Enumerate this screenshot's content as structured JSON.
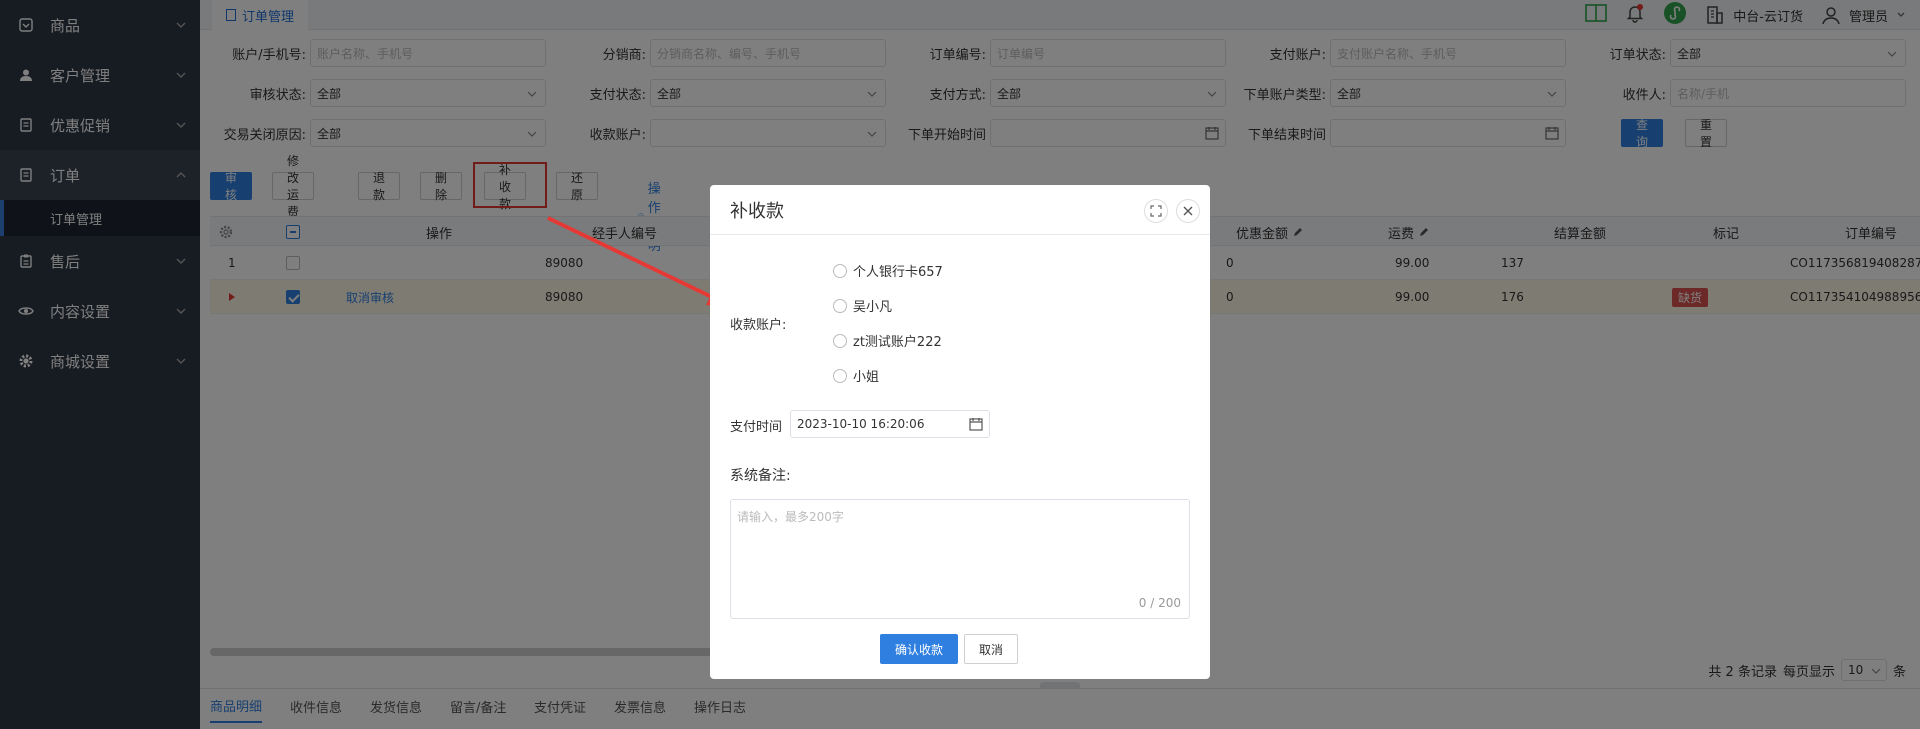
{
  "sidebar": {
    "items": [
      {
        "label": "商品",
        "icon": "box-icon"
      },
      {
        "label": "客户管理",
        "icon": "user-icon"
      },
      {
        "label": "优惠促销",
        "icon": "coupon-icon"
      },
      {
        "label": "订单",
        "icon": "order-icon"
      },
      {
        "label": "售后",
        "icon": "aftersale-icon"
      },
      {
        "label": "内容设置",
        "icon": "eye-icon"
      },
      {
        "label": "商城设置",
        "icon": "gear-icon"
      }
    ],
    "sub_active": "订单管理"
  },
  "tabs": {
    "active": "订单管理"
  },
  "header": {
    "org": "中台-云订货",
    "user": "管理员"
  },
  "filters": {
    "account_label": "账户/手机号:",
    "account_ph": "账户名称、手机号",
    "distributor_label": "分销商:",
    "distributor_ph": "分销商名称、编号、手机号",
    "order_no_label": "订单编号:",
    "order_no_ph": "订单编号",
    "pay_account_label": "支付账户:",
    "pay_account_ph": "支付账户名称、手机号",
    "order_status_label": "订单状态:",
    "order_status_val": "全部",
    "audit_label": "审核状态:",
    "audit_val": "全部",
    "pay_status_label": "支付状态:",
    "pay_status_val": "全部",
    "pay_method_label": "支付方式:",
    "pay_method_val": "全部",
    "acct_type_label": "下单账户类型:",
    "acct_type_val": "全部",
    "receiver_label": "收件人:",
    "receiver_ph": "名称/手机",
    "close_reason_label": "交易关闭原因:",
    "close_reason_val": "全部",
    "collect_acct_label": "收款账户:",
    "collect_acct_val": "",
    "start_label": "下单开始时间",
    "end_label": "下单结束时间",
    "query": "查询",
    "reset": "重置"
  },
  "toolbar": {
    "audit": "审核",
    "modify_freight": "修改运费",
    "refund": "退款",
    "delete": "删除",
    "supplement": "补收款",
    "restore": "还原",
    "help": "操作说明"
  },
  "table": {
    "headers": {
      "op": "操作",
      "agent": "经手人编号",
      "discount": "优惠金额",
      "freight": "运费",
      "settle": "结算金额",
      "mark": "标记",
      "order_no": "订单编号"
    },
    "rows": [
      {
        "idx": "1",
        "op": "",
        "agent": "89080",
        "discount": "0",
        "freight": "99.00",
        "settle": "137",
        "mark": "",
        "order_no": "CO117356819408287"
      },
      {
        "idx": "",
        "op": "取消审核",
        "agent": "89080",
        "discount": "0",
        "freight": "99.00",
        "settle": "176",
        "mark": "缺货",
        "order_no": "CO117354104988956"
      }
    ]
  },
  "pager": {
    "total": "共 2 条记录",
    "per_page_label": "每页显示",
    "per_page": "10",
    "unit": "条"
  },
  "bottom_tabs": [
    "商品明细",
    "收件信息",
    "发货信息",
    "留言/备注",
    "支付凭证",
    "发票信息",
    "操作日志"
  ],
  "modal": {
    "title": "补收款",
    "account_label": "收款账户:",
    "accounts": [
      "个人银行卡657",
      "吴小凡",
      "zt测试账户222",
      "小姐"
    ],
    "pay_time_label": "支付时间",
    "pay_time": "2023-10-10 16:20:06",
    "remark_label": "系统备注:",
    "remark_ph": "请输入，最多200字",
    "remark_count": "0 / 200",
    "confirm": "确认收款",
    "cancel": "取消"
  }
}
